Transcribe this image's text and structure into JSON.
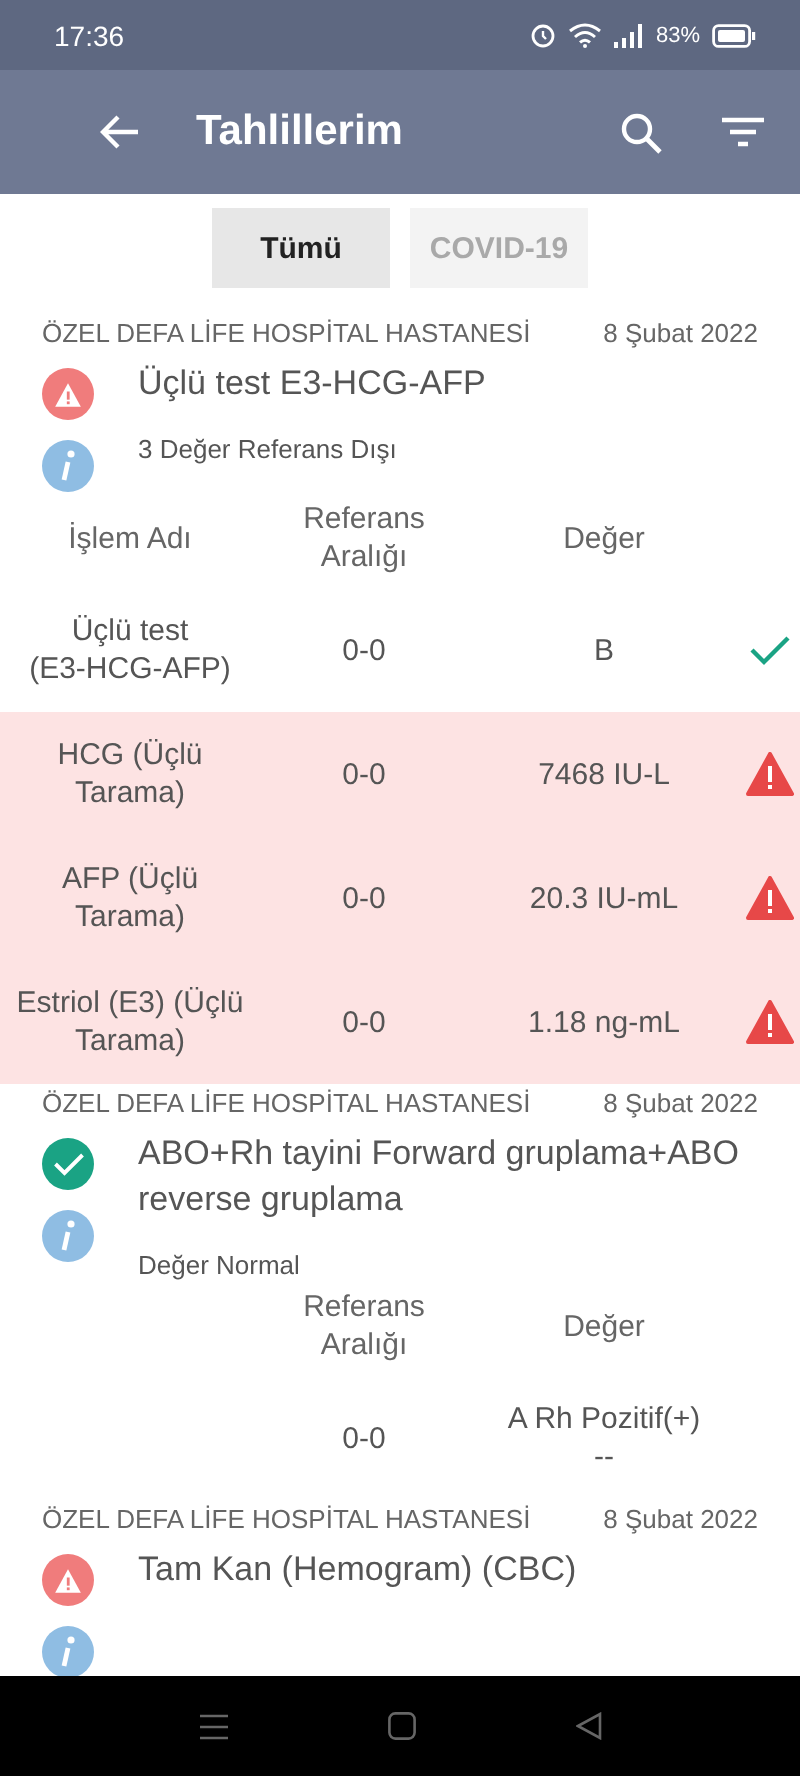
{
  "status_bar": {
    "time": "17:36",
    "battery": "83%"
  },
  "app_bar": {
    "title": "Tahlillerim"
  },
  "tabs": [
    {
      "label": "Tümü",
      "selected": true
    },
    {
      "label": "COVID-19",
      "selected": false
    }
  ],
  "results": [
    {
      "hospital": "ÖZEL DEFA LİFE HOSPİTAL HASTANESİ",
      "date": "8 Şubat 2022",
      "kind": "alert",
      "title": "Üçlü test E3-HCG-AFP",
      "summary": "3 Değer Referans Dışı",
      "headers": {
        "name": "İşlem Adı",
        "reference": "Referans Aralığı",
        "value": "Değer"
      },
      "rows": [
        {
          "name": "Üçlü test (E3-HCG-AFP)",
          "reference": "0-0",
          "value": "B",
          "abnormal": false
        },
        {
          "name": "HCG (Üçlü Tarama)",
          "reference": "0-0",
          "value": "7468 IU-L",
          "abnormal": true
        },
        {
          "name": "AFP (Üçlü Tarama)",
          "reference": "0-0",
          "value": "20.3 IU-mL",
          "abnormal": true
        },
        {
          "name": "Estriol (E3) (Üçlü Tarama)",
          "reference": "0-0",
          "value": "1.18 ng-mL",
          "abnormal": true
        }
      ]
    },
    {
      "hospital": "ÖZEL DEFA LİFE HOSPİTAL HASTANESİ",
      "date": "8 Şubat 2022",
      "kind": "normal",
      "title": "ABO+Rh tayini Forward gruplama+ABO reverse gruplama",
      "summary": "Değer Normal",
      "headers": {
        "reference": "Referans Aralığı",
        "value": "Değer"
      },
      "rows": [
        {
          "reference": "0-0",
          "value": "A Rh Pozitif(+)",
          "note": "--",
          "abnormal": false,
          "kind": "plain"
        }
      ]
    },
    {
      "hospital": "ÖZEL DEFA LİFE HOSPİTAL HASTANESİ",
      "date": "8 Şubat 2022",
      "kind": "alert",
      "title": "Tam Kan (Hemogram) (CBC)"
    }
  ]
}
